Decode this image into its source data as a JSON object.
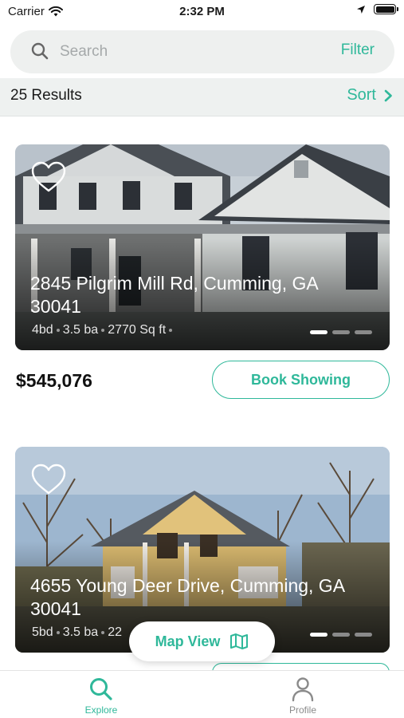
{
  "status_bar": {
    "carrier": "Carrier",
    "time": "2:32 PM"
  },
  "search": {
    "placeholder": "Search",
    "filter_label": "Filter"
  },
  "results": {
    "count_label": "25 Results",
    "sort_label": "Sort"
  },
  "listings": [
    {
      "address": "2845 Pilgrim Mill Rd, Cumming, GA 30041",
      "beds": "4bd",
      "baths": "3.5 ba",
      "sqft": "2770 Sq ft",
      "price": "$545,076",
      "action_label": "Book Showing"
    },
    {
      "address": "4655 Young Deer Drive, Cumming, GA 30041",
      "beds": "5bd",
      "baths": "3.5 ba",
      "sqft": "22"
    }
  ],
  "map_view": {
    "label": "Map View"
  },
  "tab_bar": {
    "items": [
      {
        "label": "Explore",
        "icon": "search-icon",
        "active": true
      },
      {
        "label": "Profile",
        "icon": "person-icon",
        "active": false
      }
    ]
  },
  "colors": {
    "accent": "#2fb89a",
    "search_bg": "#eef0ef",
    "results_bg": "#eef1f0"
  }
}
